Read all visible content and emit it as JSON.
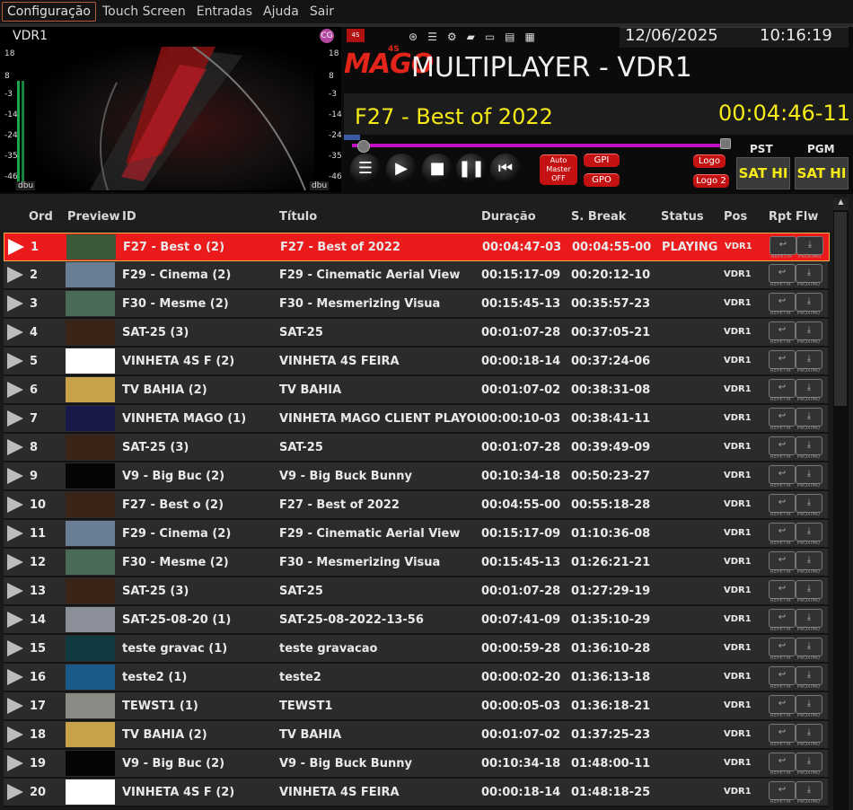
{
  "menu": [
    "Configuração",
    "Touch Screen",
    "Entradas",
    "Ajuda",
    "Sair"
  ],
  "header": {
    "date": "12/06/2025",
    "time": "10:16:19",
    "status_icons": [
      "network-icon",
      "list-icon",
      "settings-list-icon",
      "folder-icon",
      "monitor-icon",
      "hdd-icon",
      "keyboard-icon"
    ]
  },
  "preview": {
    "label": "VDR1",
    "vu_scale": [
      "18",
      "8",
      "-3",
      "-14",
      "-24",
      "-35",
      "-46"
    ],
    "vu_unit": "dbu",
    "badge_pink": "CG",
    "badge_red": "4S"
  },
  "player": {
    "brand": "MAGO",
    "brand_sup": "4S",
    "title": "MULTIPLAYER - VDR1",
    "current_title": "F27 - Best of 2022",
    "current_timecode": "00:04:46-11",
    "progress_fraction": 0.03,
    "auto_master": "Auto Master OFF",
    "gpi": "GPI",
    "gpo": "GPO",
    "logo": "Logo",
    "logo2": "Logo 2",
    "pst_label": "PST",
    "pgm_label": "PGM",
    "pst_value": "SAT HI",
    "pgm_value": "SAT HI"
  },
  "table": {
    "headers": {
      "ord": "Ord",
      "preview": "Preview",
      "id": "ID",
      "titulo": "Título",
      "duracao": "Duração",
      "sbreak": "S. Break",
      "status": "Status",
      "pos": "Pos",
      "rpt": "Rpt",
      "flw": "Flw"
    },
    "repeat_label": "REPETIR",
    "next_label": "PRÓXIMO",
    "rows": [
      {
        "ord": "1",
        "id": "F27 - Best o (2)",
        "titulo": "F27 - Best of 2022",
        "duracao": "00:04:47-03",
        "sbreak": "00:04:55-00",
        "status": "PLAYING",
        "pos": "VDR1"
      },
      {
        "ord": "2",
        "id": "F29 - Cinema (2)",
        "titulo": "F29 - Cinematic Aerial View",
        "duracao": "00:15:17-09",
        "sbreak": "00:20:12-10",
        "status": "",
        "pos": "VDR1"
      },
      {
        "ord": "3",
        "id": "F30 -  Mesme (2)",
        "titulo": "F30 -  Mesmerizing Visua",
        "duracao": "00:15:45-13",
        "sbreak": "00:35:57-23",
        "status": "",
        "pos": "VDR1"
      },
      {
        "ord": "4",
        "id": "SAT-25 (3)",
        "titulo": "SAT-25",
        "duracao": "00:01:07-28",
        "sbreak": "00:37:05-21",
        "status": "",
        "pos": "VDR1"
      },
      {
        "ord": "5",
        "id": "VINHETA 4S F (2)",
        "titulo": "VINHETA 4S FEIRA",
        "duracao": "00:00:18-14",
        "sbreak": "00:37:24-06",
        "status": "",
        "pos": "VDR1"
      },
      {
        "ord": "6",
        "id": "TV BAHIA (2)",
        "titulo": "TV BAHIA",
        "duracao": "00:01:07-02",
        "sbreak": "00:38:31-08",
        "status": "",
        "pos": "VDR1"
      },
      {
        "ord": "7",
        "id": "VINHETA MAGO (1)",
        "titulo": "VINHETA MAGO CLIENT PLAYOUT",
        "duracao": "00:00:10-03",
        "sbreak": "00:38:41-11",
        "status": "",
        "pos": "VDR1"
      },
      {
        "ord": "8",
        "id": "SAT-25 (3)",
        "titulo": "SAT-25",
        "duracao": "00:01:07-28",
        "sbreak": "00:39:49-09",
        "status": "",
        "pos": "VDR1"
      },
      {
        "ord": "9",
        "id": "V9 - Big Buc (2)",
        "titulo": "V9 - Big Buck Bunny",
        "duracao": "00:10:34-18",
        "sbreak": "00:50:23-27",
        "status": "",
        "pos": "VDR1"
      },
      {
        "ord": "10",
        "id": "F27 - Best o (2)",
        "titulo": "F27 - Best of 2022",
        "duracao": "00:04:55-00",
        "sbreak": "00:55:18-28",
        "status": "",
        "pos": "VDR1"
      },
      {
        "ord": "11",
        "id": "F29 - Cinema (2)",
        "titulo": "F29 - Cinematic Aerial View",
        "duracao": "00:15:17-09",
        "sbreak": "01:10:36-08",
        "status": "",
        "pos": "VDR1"
      },
      {
        "ord": "12",
        "id": "F30 -  Mesme (2)",
        "titulo": "F30 -  Mesmerizing Visua",
        "duracao": "00:15:45-13",
        "sbreak": "01:26:21-21",
        "status": "",
        "pos": "VDR1"
      },
      {
        "ord": "13",
        "id": "SAT-25 (3)",
        "titulo": "SAT-25",
        "duracao": "00:01:07-28",
        "sbreak": "01:27:29-19",
        "status": "",
        "pos": "VDR1"
      },
      {
        "ord": "14",
        "id": "SAT-25-08-20 (1)",
        "titulo": "SAT-25-08-2022-13-56",
        "duracao": "00:07:41-09",
        "sbreak": "01:35:10-29",
        "status": "",
        "pos": "VDR1"
      },
      {
        "ord": "15",
        "id": "teste gravac (1)",
        "titulo": "teste gravacao",
        "duracao": "00:00:59-28",
        "sbreak": "01:36:10-28",
        "status": "",
        "pos": "VDR1"
      },
      {
        "ord": "16",
        "id": "teste2 (1)",
        "titulo": "teste2",
        "duracao": "00:00:02-20",
        "sbreak": "01:36:13-18",
        "status": "",
        "pos": "VDR1"
      },
      {
        "ord": "17",
        "id": "TEWST1 (1)",
        "titulo": "TEWST1",
        "duracao": "00:00:05-03",
        "sbreak": "01:36:18-21",
        "status": "",
        "pos": "VDR1"
      },
      {
        "ord": "18",
        "id": "TV BAHIA (2)",
        "titulo": "TV BAHIA",
        "duracao": "00:01:07-02",
        "sbreak": "01:37:25-23",
        "status": "",
        "pos": "VDR1"
      },
      {
        "ord": "19",
        "id": "V9 - Big Buc (2)",
        "titulo": "V9 - Big Buck Bunny",
        "duracao": "00:10:34-18",
        "sbreak": "01:48:00-11",
        "status": "",
        "pos": "VDR1"
      },
      {
        "ord": "20",
        "id": "VINHETA 4S F (2)",
        "titulo": "VINHETA 4S FEIRA",
        "duracao": "00:00:18-14",
        "sbreak": "01:48:18-25",
        "status": "",
        "pos": "VDR1"
      }
    ],
    "thumb_colors": [
      "#3a5a3a",
      "#6a7f96",
      "#4a6b55",
      "#3a2418",
      "#ffffff",
      "#c8a24a",
      "#1a1a4a",
      "#3a2418",
      "#050505",
      "#3a2418",
      "#6a7f96",
      "#4a6b55",
      "#3a2418",
      "#8a8f9a",
      "#103a40",
      "#1a5a8a",
      "#8a8a84",
      "#c8a24a",
      "#050505",
      "#ffffff"
    ]
  }
}
